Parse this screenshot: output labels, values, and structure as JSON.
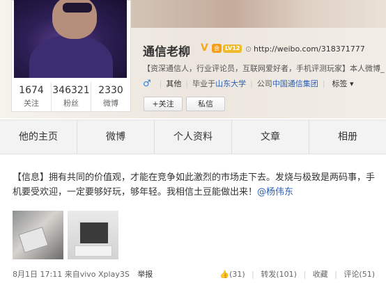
{
  "profile": {
    "name": "通信老柳",
    "vip": "会",
    "level": "LV12",
    "url": "http://weibo.com/318371777",
    "bio": "【资深通信人，行业评论员，互联网爱好者，手机评测玩家】本人微博_",
    "gender_icon": "♂",
    "location": "其他",
    "school_prefix": "毕业于",
    "school": "山东大学",
    "company_prefix": "公司",
    "company": "中国通信集团",
    "tags": "标签 ▾",
    "follow_label": "+关注",
    "message_label": "私信"
  },
  "stats": [
    {
      "value": "1674",
      "label": "关注"
    },
    {
      "value": "346321",
      "label": "粉丝"
    },
    {
      "value": "2330",
      "label": "微博"
    }
  ],
  "tabs": [
    "他的主页",
    "微博",
    "个人资料",
    "文章",
    "相册"
  ],
  "post": {
    "text": "【信息】拥有共同的价值观，才能在竞争如此激烈的市场走下去。发烧与极致是两码事，手机要受欢迎，一定要够好玩，够年轻。我相信土豆能做出来！",
    "mention": "@杨伟东",
    "time": "8月1日 17:11",
    "source": "来自vivo Xplay3S",
    "report": "举报",
    "like_count": "(31)",
    "repost": "转发(101)",
    "favorite": "收藏",
    "comment": "评论(51)"
  }
}
